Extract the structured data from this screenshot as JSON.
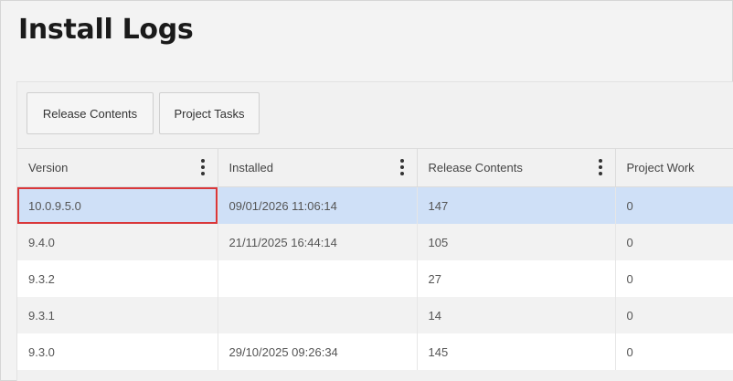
{
  "page": {
    "title": "Install Logs"
  },
  "toolbar": {
    "release_contents_label": "Release Contents",
    "project_tasks_label": "Project Tasks"
  },
  "table": {
    "columns": [
      "Version",
      "Installed",
      "Release Contents",
      "Project Work"
    ],
    "rows": [
      [
        "10.0.9.5.0",
        "09/01/2026 11:06:14",
        "147",
        "0"
      ],
      [
        "9.4.0",
        "21/11/2025 16:44:14",
        "105",
        "0"
      ],
      [
        "9.3.2",
        "",
        "27",
        "0"
      ],
      [
        "9.3.1",
        "",
        "14",
        "0"
      ],
      [
        "9.3.0",
        "29/10/2025 09:26:34",
        "145",
        "0"
      ]
    ]
  },
  "colors": {
    "selected_row": "#cfe0f7",
    "focus_outline": "#d9383a"
  }
}
